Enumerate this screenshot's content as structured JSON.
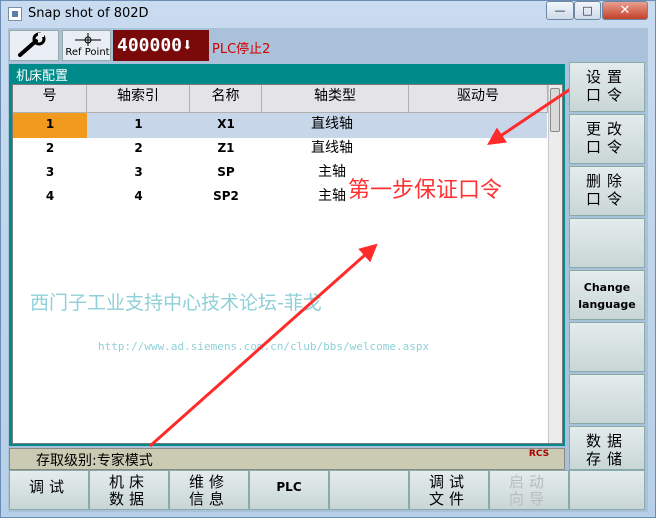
{
  "window": {
    "title": "Snap shot of 802D",
    "min_label": "—",
    "max_label": "□",
    "close_label": "✕"
  },
  "toolbar": {
    "ref_point_label": "Ref Point",
    "mode_value": "400000",
    "mode_arrow": "⬇",
    "plc_status": "PLC停止2"
  },
  "panel": {
    "title": "机床配置",
    "columns": [
      "号",
      "轴索引",
      "名称",
      "轴类型",
      "驱动号"
    ],
    "rows": [
      [
        "1",
        "1",
        "X1",
        "直线轴",
        ""
      ],
      [
        "2",
        "2",
        "Z1",
        "直线轴",
        ""
      ],
      [
        "3",
        "3",
        "SP",
        "主轴",
        ""
      ],
      [
        "4",
        "4",
        "SP2",
        "主轴",
        ""
      ]
    ]
  },
  "annotations": {
    "step": "第一步保证口令",
    "forum": "西门子工业支持中心技术论坛-菲戈",
    "url": "http://www.ad.siemens.com.cn/club/bbs/welcome.aspx"
  },
  "status": {
    "access_level": "存取级别:专家模式",
    "rcs_label": "RCS"
  },
  "softkeys_vertical": [
    {
      "line1": "设置",
      "line2": "口令"
    },
    {
      "line1": "更改",
      "line2": "口令"
    },
    {
      "line1": "删除",
      "line2": "口令"
    },
    {
      "line1": "",
      "line2": ""
    },
    {
      "line1": "Change",
      "line2": "language"
    },
    {
      "line1": "",
      "line2": ""
    },
    {
      "line1": "",
      "line2": ""
    },
    {
      "line1": "数据",
      "line2": "存储"
    }
  ],
  "softkeys_horizontal": [
    {
      "line1": "调试",
      "line2": ""
    },
    {
      "line1": "机床",
      "line2": "数据"
    },
    {
      "line1": "维修",
      "line2": "信息"
    },
    {
      "line1": "PLC",
      "line2": ""
    },
    {
      "line1": "",
      "line2": ""
    },
    {
      "line1": "调试",
      "line2": "文件"
    },
    {
      "line1": "启动",
      "line2": "向导"
    },
    {
      "line1": "",
      "line2": ""
    }
  ],
  "colors": {
    "panel_teal": "#008a8a",
    "mode_bg": "#7a0a0a",
    "plc_red": "#d00000",
    "selected_index": "#f29a1e",
    "selected_row": "#c8d6ea",
    "annotation_red": "#ff3030"
  }
}
